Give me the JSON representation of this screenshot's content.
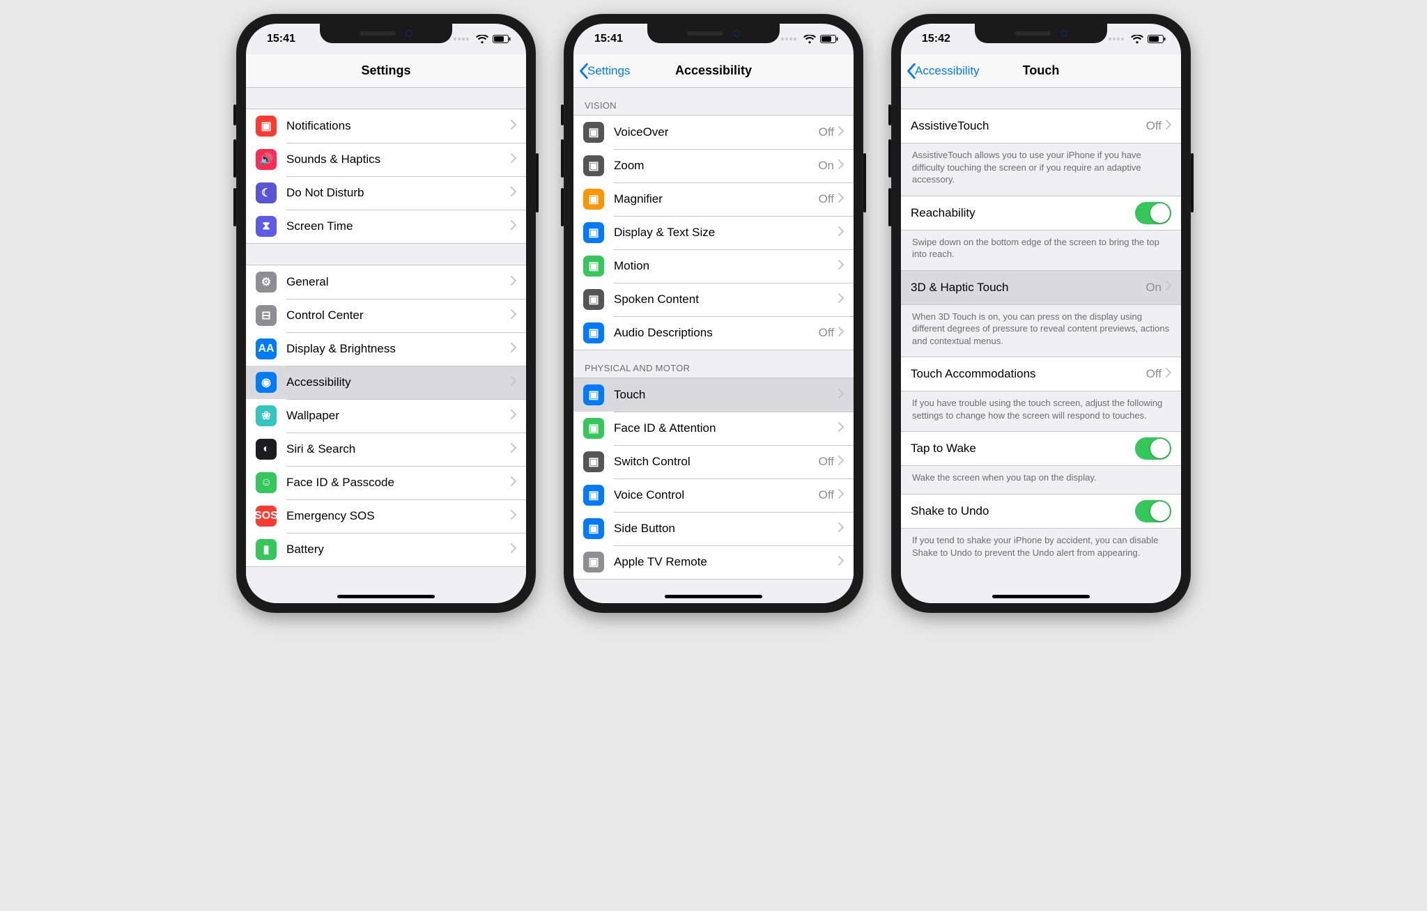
{
  "status": {
    "phone1_time": "15:41",
    "phone2_time": "15:41",
    "phone3_time": "15:42"
  },
  "phone1": {
    "title": "Settings",
    "group1": [
      {
        "icon": "square-red",
        "label": "Notifications",
        "color": "bg-red"
      },
      {
        "icon": "sound",
        "label": "Sounds & Haptics",
        "color": "bg-pink"
      },
      {
        "icon": "moon",
        "label": "Do Not Disturb",
        "color": "bg-purple"
      },
      {
        "icon": "hourglass",
        "label": "Screen Time",
        "color": "bg-purple2"
      }
    ],
    "group2": [
      {
        "icon": "gear",
        "label": "General",
        "color": "bg-gray"
      },
      {
        "icon": "toggles",
        "label": "Control Center",
        "color": "bg-gray"
      },
      {
        "icon": "AA",
        "label": "Display & Brightness",
        "color": "bg-blue"
      },
      {
        "icon": "person",
        "label": "Accessibility",
        "color": "bg-blue",
        "selected": true
      },
      {
        "icon": "flower",
        "label": "Wallpaper",
        "color": "bg-cyan"
      },
      {
        "icon": "siri",
        "label": "Siri & Search",
        "color": "bg-darkb"
      },
      {
        "icon": "face",
        "label": "Face ID & Passcode",
        "color": "bg-green"
      },
      {
        "icon": "SOS",
        "label": "Emergency SOS",
        "color": "bg-sos"
      },
      {
        "icon": "battery",
        "label": "Battery",
        "color": "bg-green"
      }
    ]
  },
  "phone2": {
    "back": "Settings",
    "title": "Accessibility",
    "section1_header": "VISION",
    "section1": [
      {
        "label": "VoiceOver",
        "value": "Off",
        "color": "bg-dgray"
      },
      {
        "label": "Zoom",
        "value": "On",
        "color": "bg-dgray"
      },
      {
        "label": "Magnifier",
        "value": "Off",
        "color": "bg-orange"
      },
      {
        "label": "Display & Text Size",
        "value": "",
        "color": "bg-blue"
      },
      {
        "label": "Motion",
        "value": "",
        "color": "bg-green"
      },
      {
        "label": "Spoken Content",
        "value": "",
        "color": "bg-dgray"
      },
      {
        "label": "Audio Descriptions",
        "value": "Off",
        "color": "bg-blue"
      }
    ],
    "section2_header": "PHYSICAL AND MOTOR",
    "section2": [
      {
        "label": "Touch",
        "value": "",
        "color": "bg-blue",
        "selected": true
      },
      {
        "label": "Face ID & Attention",
        "value": "",
        "color": "bg-green"
      },
      {
        "label": "Switch Control",
        "value": "Off",
        "color": "bg-dgray"
      },
      {
        "label": "Voice Control",
        "value": "Off",
        "color": "bg-blue"
      },
      {
        "label": "Side Button",
        "value": "",
        "color": "bg-blue"
      },
      {
        "label": "Apple TV Remote",
        "value": "",
        "color": "bg-gray"
      }
    ]
  },
  "phone3": {
    "back": "Accessibility",
    "title": "Touch",
    "items": [
      {
        "type": "link",
        "label": "AssistiveTouch",
        "value": "Off",
        "note": "AssistiveTouch allows you to use your iPhone if you have difficulty touching the screen or if you require an adaptive accessory."
      },
      {
        "type": "switch",
        "label": "Reachability",
        "on": true,
        "note": "Swipe down on the bottom edge of the screen to bring the top into reach."
      },
      {
        "type": "link",
        "label": "3D & Haptic Touch",
        "value": "On",
        "selected": true,
        "note": "When 3D Touch is on, you can press on the display using different degrees of pressure to reveal content previews, actions and contextual menus."
      },
      {
        "type": "link",
        "label": "Touch Accommodations",
        "value": "Off",
        "note": "If you have trouble using the touch screen, adjust the following settings to change how the screen will respond to touches."
      },
      {
        "type": "switch",
        "label": "Tap to Wake",
        "on": true,
        "note": "Wake the screen when you tap on the display."
      },
      {
        "type": "switch",
        "label": "Shake to Undo",
        "on": true,
        "note": "If you tend to shake your iPhone by accident, you can disable Shake to Undo to prevent the Undo alert from appearing."
      }
    ]
  }
}
